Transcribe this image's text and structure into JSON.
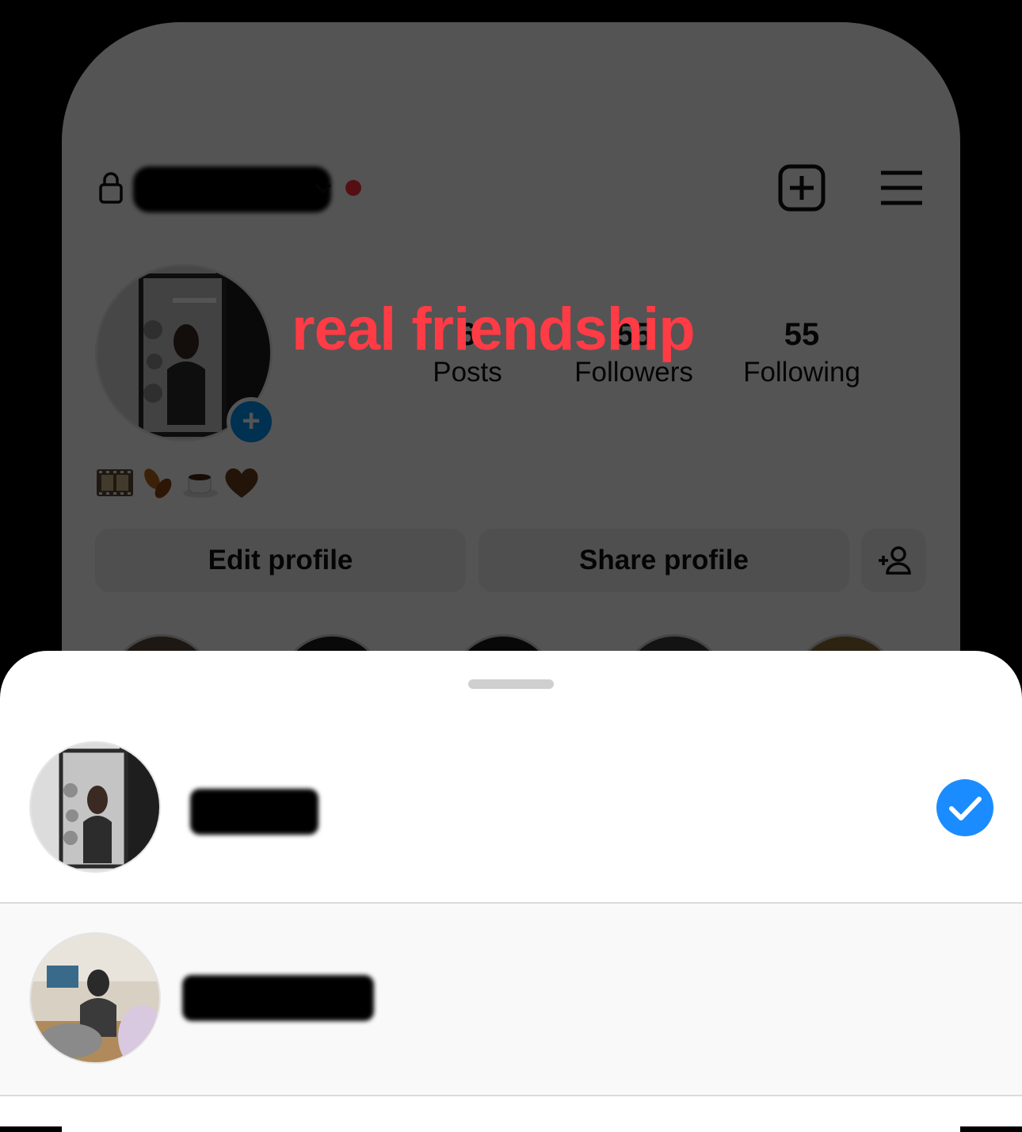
{
  "profile": {
    "stats": [
      {
        "value": "6",
        "label": "Posts"
      },
      {
        "value": "55",
        "label": "Followers"
      },
      {
        "value": "55",
        "label": "Following"
      }
    ],
    "bio_emojis": [
      "🎞️",
      "🍂",
      "☕",
      "🤎"
    ],
    "add_story_symbol": "+"
  },
  "overlay_caption": "real friendship",
  "buttons": {
    "edit_profile": "Edit profile",
    "share_profile": "Share profile"
  },
  "icons": {
    "lock": "lock-icon",
    "chevron": "chevron-down-icon",
    "new_post": "plus-square-icon",
    "menu": "hamburger-menu-icon",
    "add_person": "add-person-icon",
    "check": "check-circle-icon"
  },
  "colors": {
    "accent": "#0095f6",
    "notification": "#ff3040",
    "caption": "#ff3b45",
    "check": "#1a8cff"
  },
  "account_switcher": {
    "accounts": [
      {
        "selected": true
      },
      {
        "selected": false
      }
    ]
  }
}
